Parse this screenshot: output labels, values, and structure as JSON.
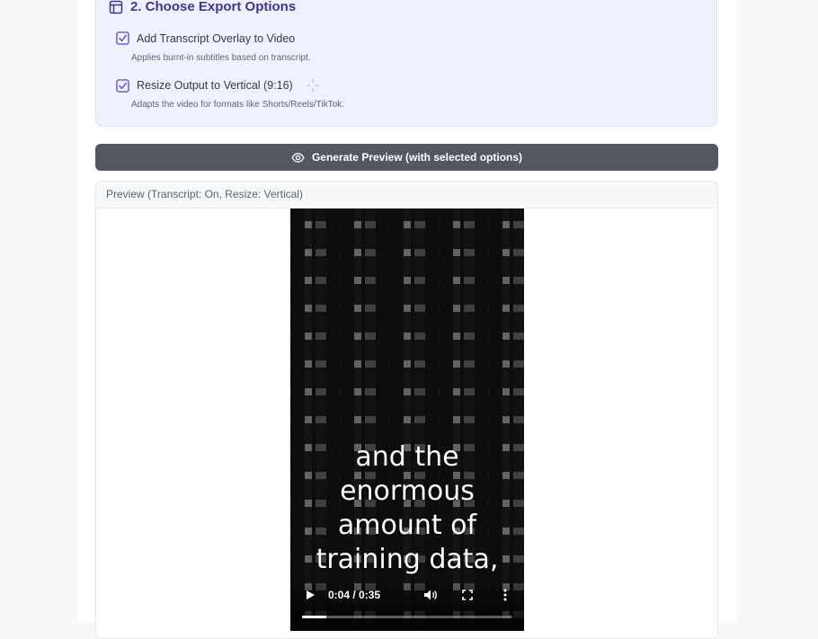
{
  "export_options": {
    "title": "2. Choose Export Options",
    "options": [
      {
        "label": "Add Transcript Overlay to Video",
        "hint": "Applies burnt-in subtitles based on transcript.",
        "checked": true
      },
      {
        "label": "Resize Output to Vertical (9:16)",
        "hint": "Adapts the video for formats like Shorts/Reels/TikTok.",
        "checked": true
      }
    ]
  },
  "generate_button": {
    "label": "Generate Preview (with selected options)",
    "icon": "eye-icon"
  },
  "preview": {
    "header": "Preview (Transcript: On, Resize: Vertical)",
    "caption_lines": [
      "and the",
      "enormous",
      "amount of",
      "training data,"
    ],
    "time": "0:04 / 0:35",
    "progress": 0.114
  },
  "colors": {
    "accent": "#5a55d6",
    "title": "#3a3790",
    "button": "#555760"
  }
}
